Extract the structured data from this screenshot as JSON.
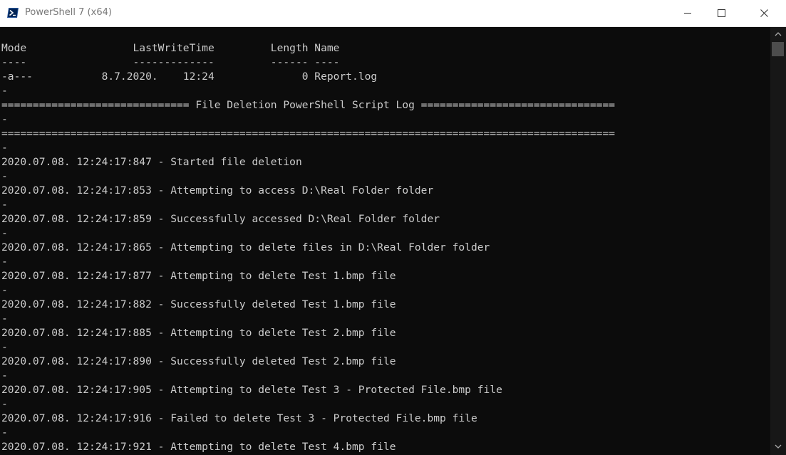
{
  "window": {
    "title": "PowerShell 7 (x64)",
    "icon": "powershell-icon",
    "controls": [
      "minimize-icon",
      "maximize-icon",
      "close-icon"
    ]
  },
  "colors": {
    "background": "#0c0c0c",
    "foreground": "#cccccc",
    "titlebar": "#ffffff",
    "title_text": "#777777",
    "icon_blue": "#012456"
  },
  "console": {
    "lines": [
      "",
      "Mode                 LastWriteTime         Length Name",
      "----                 -------------         ------ ----",
      "-a---           8.7.2020.    12:24              0 Report.log",
      "-",
      "============================== File Deletion PowerShell Script Log ===============================",
      "-",
      "==================================================================================================",
      "-",
      "2020.07.08. 12:24:17:847 - Started file deletion",
      "-",
      "2020.07.08. 12:24:17:853 - Attempting to access D:\\Real Folder folder",
      "-",
      "2020.07.08. 12:24:17:859 - Successfully accessed D:\\Real Folder folder",
      "-",
      "2020.07.08. 12:24:17:865 - Attempting to delete files in D:\\Real Folder folder",
      "-",
      "2020.07.08. 12:24:17:877 - Attempting to delete Test 1.bmp file",
      "-",
      "2020.07.08. 12:24:17:882 - Successfully deleted Test 1.bmp file",
      "-",
      "2020.07.08. 12:24:17:885 - Attempting to delete Test 2.bmp file",
      "-",
      "2020.07.08. 12:24:17:890 - Successfully deleted Test 2.bmp file",
      "-",
      "2020.07.08. 12:24:17:905 - Attempting to delete Test 3 - Protected File.bmp file",
      "-",
      "2020.07.08. 12:24:17:916 - Failed to delete Test 3 - Protected File.bmp file",
      "-",
      "2020.07.08. 12:24:17:921 - Attempting to delete Test 4.bmp file"
    ]
  },
  "scrollbar": {
    "up_icon": "scroll-up-arrow-icon",
    "down_icon": "scroll-down-arrow-icon"
  }
}
